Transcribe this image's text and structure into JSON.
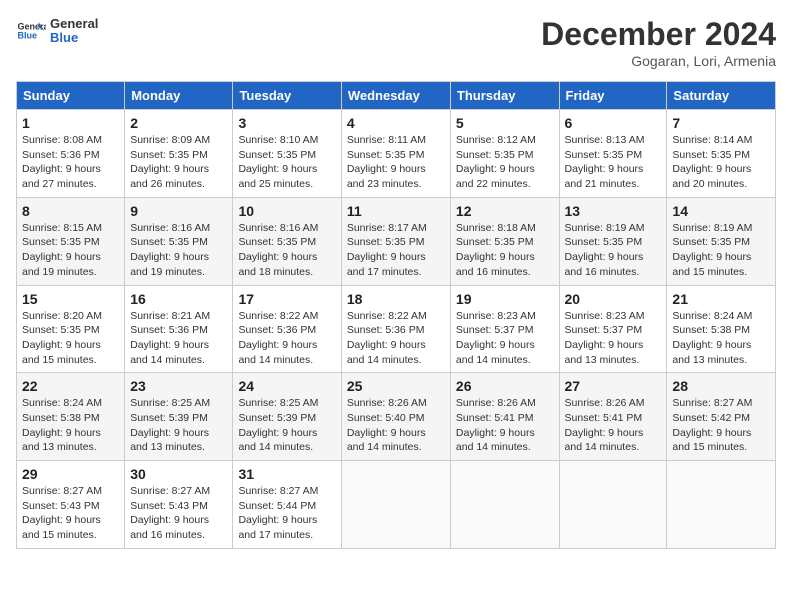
{
  "header": {
    "logo": {
      "general": "General",
      "blue": "Blue"
    },
    "month_title": "December 2024",
    "subtitle": "Gogaran, Lori, Armenia"
  },
  "weekdays": [
    "Sunday",
    "Monday",
    "Tuesday",
    "Wednesday",
    "Thursday",
    "Friday",
    "Saturday"
  ],
  "weeks": [
    [
      {
        "day": "1",
        "sunrise": "8:08 AM",
        "sunset": "5:36 PM",
        "daylight": "9 hours and 27 minutes."
      },
      {
        "day": "2",
        "sunrise": "8:09 AM",
        "sunset": "5:35 PM",
        "daylight": "9 hours and 26 minutes."
      },
      {
        "day": "3",
        "sunrise": "8:10 AM",
        "sunset": "5:35 PM",
        "daylight": "9 hours and 25 minutes."
      },
      {
        "day": "4",
        "sunrise": "8:11 AM",
        "sunset": "5:35 PM",
        "daylight": "9 hours and 23 minutes."
      },
      {
        "day": "5",
        "sunrise": "8:12 AM",
        "sunset": "5:35 PM",
        "daylight": "9 hours and 22 minutes."
      },
      {
        "day": "6",
        "sunrise": "8:13 AM",
        "sunset": "5:35 PM",
        "daylight": "9 hours and 21 minutes."
      },
      {
        "day": "7",
        "sunrise": "8:14 AM",
        "sunset": "5:35 PM",
        "daylight": "9 hours and 20 minutes."
      }
    ],
    [
      {
        "day": "8",
        "sunrise": "8:15 AM",
        "sunset": "5:35 PM",
        "daylight": "9 hours and 19 minutes."
      },
      {
        "day": "9",
        "sunrise": "8:16 AM",
        "sunset": "5:35 PM",
        "daylight": "9 hours and 19 minutes."
      },
      {
        "day": "10",
        "sunrise": "8:16 AM",
        "sunset": "5:35 PM",
        "daylight": "9 hours and 18 minutes."
      },
      {
        "day": "11",
        "sunrise": "8:17 AM",
        "sunset": "5:35 PM",
        "daylight": "9 hours and 17 minutes."
      },
      {
        "day": "12",
        "sunrise": "8:18 AM",
        "sunset": "5:35 PM",
        "daylight": "9 hours and 16 minutes."
      },
      {
        "day": "13",
        "sunrise": "8:19 AM",
        "sunset": "5:35 PM",
        "daylight": "9 hours and 16 minutes."
      },
      {
        "day": "14",
        "sunrise": "8:19 AM",
        "sunset": "5:35 PM",
        "daylight": "9 hours and 15 minutes."
      }
    ],
    [
      {
        "day": "15",
        "sunrise": "8:20 AM",
        "sunset": "5:35 PM",
        "daylight": "9 hours and 15 minutes."
      },
      {
        "day": "16",
        "sunrise": "8:21 AM",
        "sunset": "5:36 PM",
        "daylight": "9 hours and 14 minutes."
      },
      {
        "day": "17",
        "sunrise": "8:22 AM",
        "sunset": "5:36 PM",
        "daylight": "9 hours and 14 minutes."
      },
      {
        "day": "18",
        "sunrise": "8:22 AM",
        "sunset": "5:36 PM",
        "daylight": "9 hours and 14 minutes."
      },
      {
        "day": "19",
        "sunrise": "8:23 AM",
        "sunset": "5:37 PM",
        "daylight": "9 hours and 14 minutes."
      },
      {
        "day": "20",
        "sunrise": "8:23 AM",
        "sunset": "5:37 PM",
        "daylight": "9 hours and 13 minutes."
      },
      {
        "day": "21",
        "sunrise": "8:24 AM",
        "sunset": "5:38 PM",
        "daylight": "9 hours and 13 minutes."
      }
    ],
    [
      {
        "day": "22",
        "sunrise": "8:24 AM",
        "sunset": "5:38 PM",
        "daylight": "9 hours and 13 minutes."
      },
      {
        "day": "23",
        "sunrise": "8:25 AM",
        "sunset": "5:39 PM",
        "daylight": "9 hours and 13 minutes."
      },
      {
        "day": "24",
        "sunrise": "8:25 AM",
        "sunset": "5:39 PM",
        "daylight": "9 hours and 14 minutes."
      },
      {
        "day": "25",
        "sunrise": "8:26 AM",
        "sunset": "5:40 PM",
        "daylight": "9 hours and 14 minutes."
      },
      {
        "day": "26",
        "sunrise": "8:26 AM",
        "sunset": "5:41 PM",
        "daylight": "9 hours and 14 minutes."
      },
      {
        "day": "27",
        "sunrise": "8:26 AM",
        "sunset": "5:41 PM",
        "daylight": "9 hours and 14 minutes."
      },
      {
        "day": "28",
        "sunrise": "8:27 AM",
        "sunset": "5:42 PM",
        "daylight": "9 hours and 15 minutes."
      }
    ],
    [
      {
        "day": "29",
        "sunrise": "8:27 AM",
        "sunset": "5:43 PM",
        "daylight": "9 hours and 15 minutes."
      },
      {
        "day": "30",
        "sunrise": "8:27 AM",
        "sunset": "5:43 PM",
        "daylight": "9 hours and 16 minutes."
      },
      {
        "day": "31",
        "sunrise": "8:27 AM",
        "sunset": "5:44 PM",
        "daylight": "9 hours and 17 minutes."
      },
      null,
      null,
      null,
      null
    ]
  ],
  "labels": {
    "sunrise": "Sunrise:",
    "sunset": "Sunset:",
    "daylight": "Daylight:"
  }
}
